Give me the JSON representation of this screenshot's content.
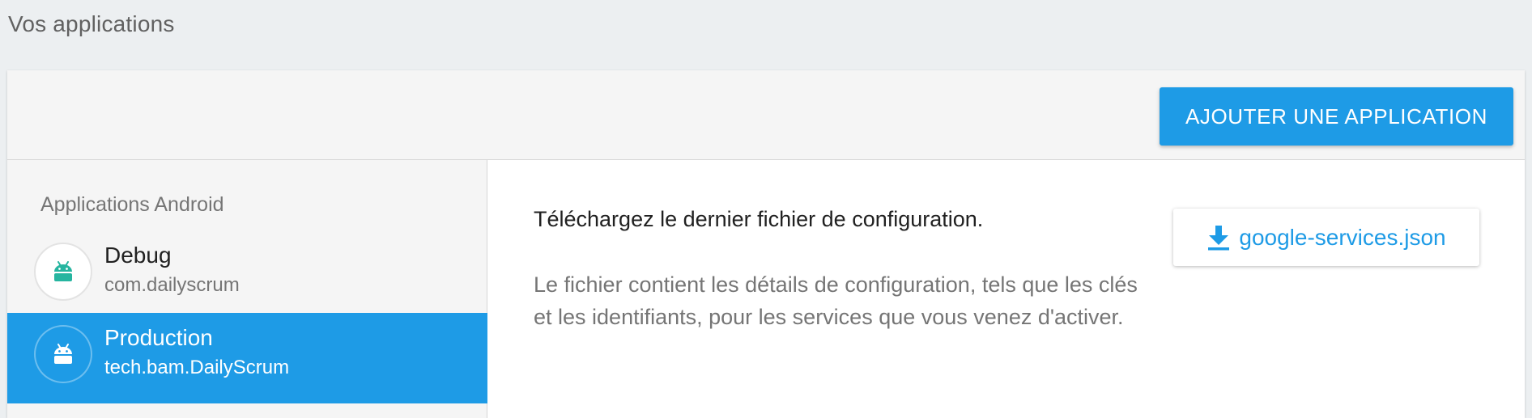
{
  "header": {
    "title": "Vos applications"
  },
  "toolbar": {
    "add_app_label": "AJOUTER UNE APPLICATION"
  },
  "sidebar": {
    "section_title": "Applications Android",
    "items": [
      {
        "name": "Debug",
        "package": "com.dailyscrum",
        "icon": "android-icon",
        "selected": false
      },
      {
        "name": "Production",
        "package": "tech.bam.DailyScrum",
        "icon": "android-icon",
        "selected": true
      }
    ]
  },
  "main": {
    "title": "Téléchargez le dernier fichier de configuration.",
    "description": "Le fichier contient les détails de configuration, tels que les clés et les identifiants, pour les services que vous venez d'activer.",
    "download": {
      "label": "google-services.json",
      "icon": "download-icon"
    }
  },
  "colors": {
    "accent": "#1e9be6",
    "android_green": "#26b5a0",
    "background": "#eceff1"
  }
}
